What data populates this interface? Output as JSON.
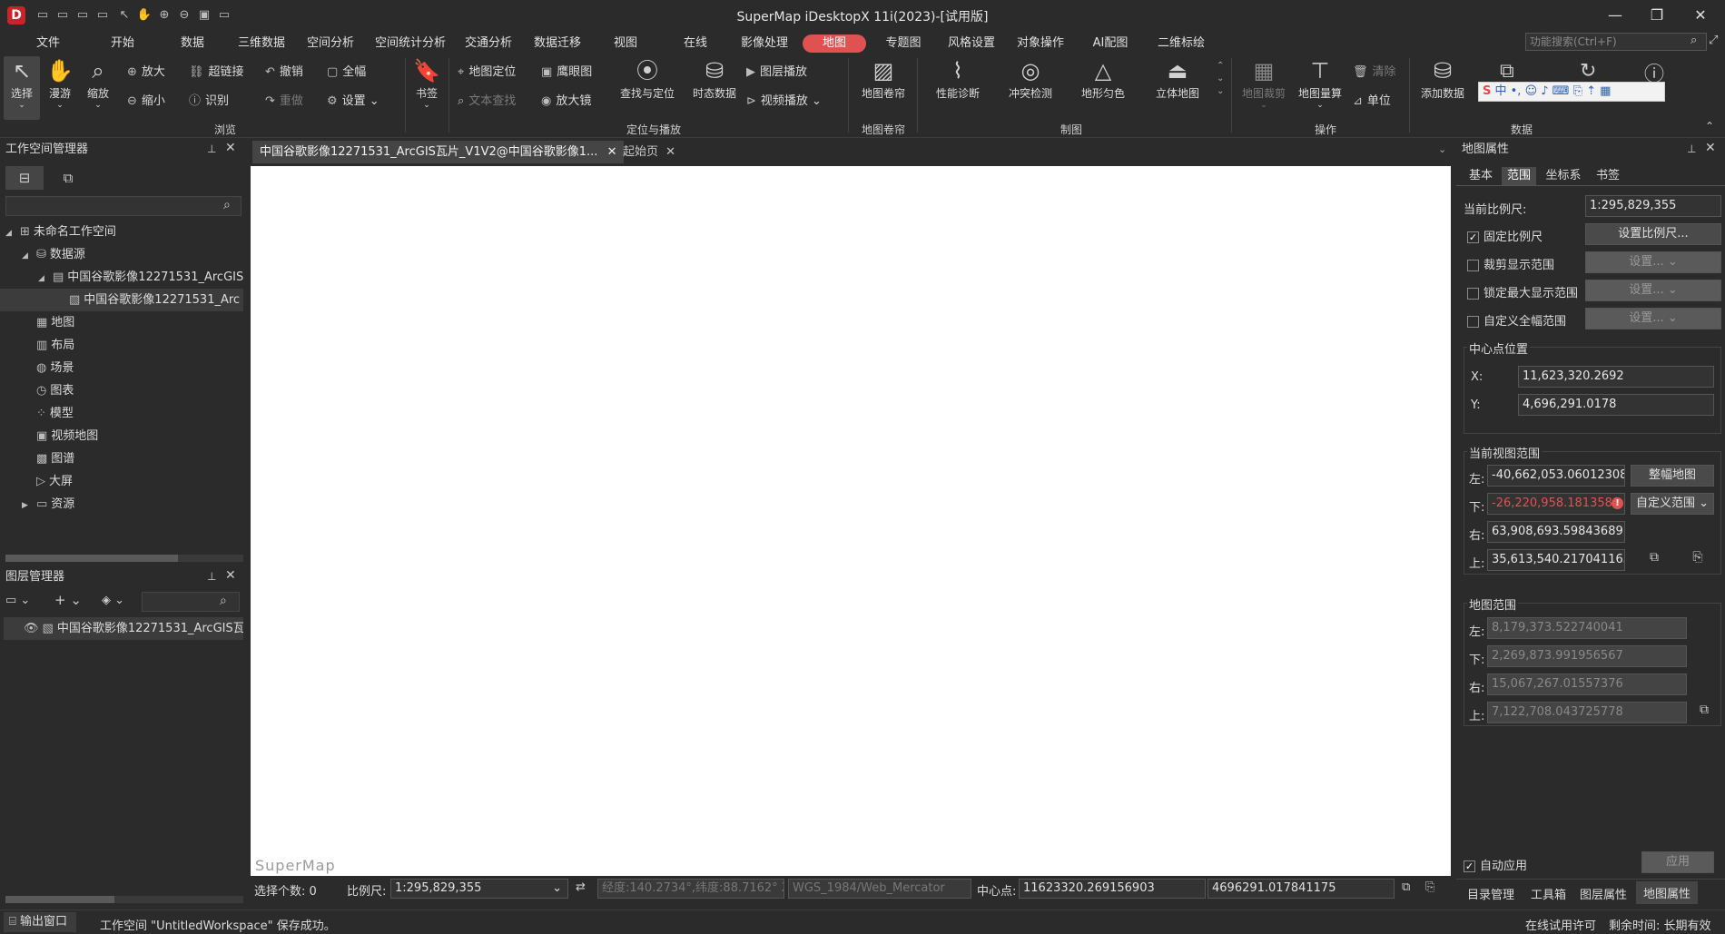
{
  "window": {
    "title": "SuperMap iDesktopX 11i(2023)-[试用版]",
    "logo": "D",
    "minimize": "—",
    "maximize": "❐",
    "close": "✕"
  },
  "quick_access": [
    "▭",
    "▭",
    "▭",
    "▭",
    "↖",
    "✋",
    "⊕",
    "⊖",
    "▣",
    "▭"
  ],
  "menu": {
    "items": [
      "文件",
      "开始",
      "数据",
      "三维数据",
      "空间分析",
      "空间统计分析",
      "交通分析",
      "数据迁移",
      "视图",
      "在线",
      "影像处理",
      "地图",
      "专题图",
      "风格设置",
      "对象操作",
      "AI配图",
      "二维标绘"
    ],
    "active": "地图",
    "search_placeholder": "功能搜索(Ctrl+F)"
  },
  "ribbon": {
    "select": "选择",
    "pan": "漫游",
    "zoom": "缩放",
    "zoom_in": "放大",
    "zoom_out": "缩小",
    "hyperlink": "超链接",
    "identify": "识别",
    "undo": "撤销",
    "redo": "重做",
    "full": "全幅",
    "settings": "设置",
    "browse_group": "浏览",
    "bookmark": "书签",
    "map_locate": "地图定位",
    "text_search": "文本查找",
    "eagle_eye": "鹰眼图",
    "magnifier": "放大镜",
    "find_locate": "查找与定位",
    "temporal": "时态数据",
    "layer_play": "图层播放",
    "video_play": "视频播放",
    "locate_group": "定位与播放",
    "map_swipe": "地图卷帘",
    "swipe_group": "地图卷帘",
    "perf_diag": "性能诊断",
    "conflict": "冲突检测",
    "terrain": "地形匀色",
    "stereo": "立体地图",
    "draw_group": "制图",
    "map_clip": "地图裁剪",
    "map_measure": "地图量算",
    "clear": "清除",
    "unit": "单位",
    "op_group": "操作",
    "add_data": "添加数据",
    "data_group": "数据"
  },
  "workspace_panel": {
    "title": "工作空间管理器",
    "tree": [
      {
        "label": "未命名工作空间",
        "level": 0,
        "icon": "⊞",
        "arrow": "◢"
      },
      {
        "label": "数据源",
        "level": 1,
        "icon": "⛁",
        "arrow": "◢"
      },
      {
        "label": "中国谷歌影像12271531_ArcGIS",
        "level": 2,
        "icon": "▤",
        "arrow": "◢"
      },
      {
        "label": "中国谷歌影像12271531_Arc",
        "level": 3,
        "icon": "▧",
        "arrow": ""
      },
      {
        "label": "地图",
        "level": 1,
        "icon": "▦",
        "arrow": ""
      },
      {
        "label": "布局",
        "level": 1,
        "icon": "▥",
        "arrow": ""
      },
      {
        "label": "场景",
        "level": 1,
        "icon": "◍",
        "arrow": ""
      },
      {
        "label": "图表",
        "level": 1,
        "icon": "◷",
        "arrow": ""
      },
      {
        "label": "模型",
        "level": 1,
        "icon": "⁘",
        "arrow": ""
      },
      {
        "label": "视频地图",
        "level": 1,
        "icon": "▣",
        "arrow": ""
      },
      {
        "label": "图谱",
        "level": 1,
        "icon": "▩",
        "arrow": ""
      },
      {
        "label": "大屏",
        "level": 1,
        "icon": "▷",
        "arrow": ""
      },
      {
        "label": "资源",
        "level": 1,
        "icon": "▭",
        "arrow": "▶"
      }
    ]
  },
  "layer_panel": {
    "title": "图层管理器",
    "layers": [
      {
        "label": "中国谷歌影像12271531_ArcGIS瓦片"
      }
    ]
  },
  "doc_tabs": [
    {
      "label": "中国谷歌影像12271531_ArcGIS瓦片_V1V2@中国谷歌影像1..."
    },
    {
      "label": "起始页"
    }
  ],
  "map_watermark": "SuperMap",
  "status": {
    "select_count_label": "选择个数: 0",
    "scale_label": "比例尺:",
    "scale_value": "1:295,829,355",
    "lonlat": "经度:140.2734°,纬度:88.7162°",
    "x_label": "X",
    "crs": "WGS_1984/Web_Mercator",
    "center_label": "中心点:",
    "center_x": "11623320.269156903",
    "center_y": "4696291.017841175"
  },
  "bottom_bar": {
    "output_window": "输出窗口",
    "message": "工作空间 \"UntitledWorkspace\" 保存成功。",
    "license": "在线试用许可",
    "remaining": "剩余时间: 长期有效"
  },
  "map_props": {
    "title": "地图属性",
    "tabs": [
      "基本",
      "范围",
      "坐标系",
      "书签"
    ],
    "active_tab": "范围",
    "current_scale_label": "当前比例尺:",
    "current_scale": "1:295,829,355",
    "fixed_scale": "固定比例尺",
    "fixed_scale_checked": true,
    "set_scale_btn": "设置比例尺...",
    "clip_display": "裁剪显示范围",
    "lock_max": "锁定最大显示范围",
    "custom_full": "自定义全幅范围",
    "set_btn": "设置...",
    "center_title": "中心点位置",
    "cx_label": "X:",
    "cx": "11,623,320.2692",
    "cy_label": "Y:",
    "cy": "4,696,291.0178",
    "view_title": "当前视图范围",
    "left_label": "左:",
    "bottom_label": "下:",
    "right_label": "右:",
    "top_label": "上:",
    "view_left": "-40,662,053.060123086",
    "view_bottom": "-26,220,958.1813588",
    "view_right": "63,908,693.59843689",
    "view_top": "35,613,540.217041165",
    "full_map_btn": "整幅地图",
    "custom_range_btn": "自定义范围",
    "bounds_title": "地图范围",
    "bounds_left": "8,179,373.522740041",
    "bounds_bottom": "2,269,873.991956567",
    "bounds_right": "15,067,267.01557376",
    "bounds_top": "7,122,708.043725778",
    "auto_apply": "自动应用",
    "auto_apply_checked": true,
    "apply_btn": "应用",
    "bottom_tabs": [
      "目录管理",
      "工具箱",
      "图层属性",
      "地图属性"
    ],
    "active_bottom_tab": "地图属性",
    "error_color": "#e05252"
  }
}
